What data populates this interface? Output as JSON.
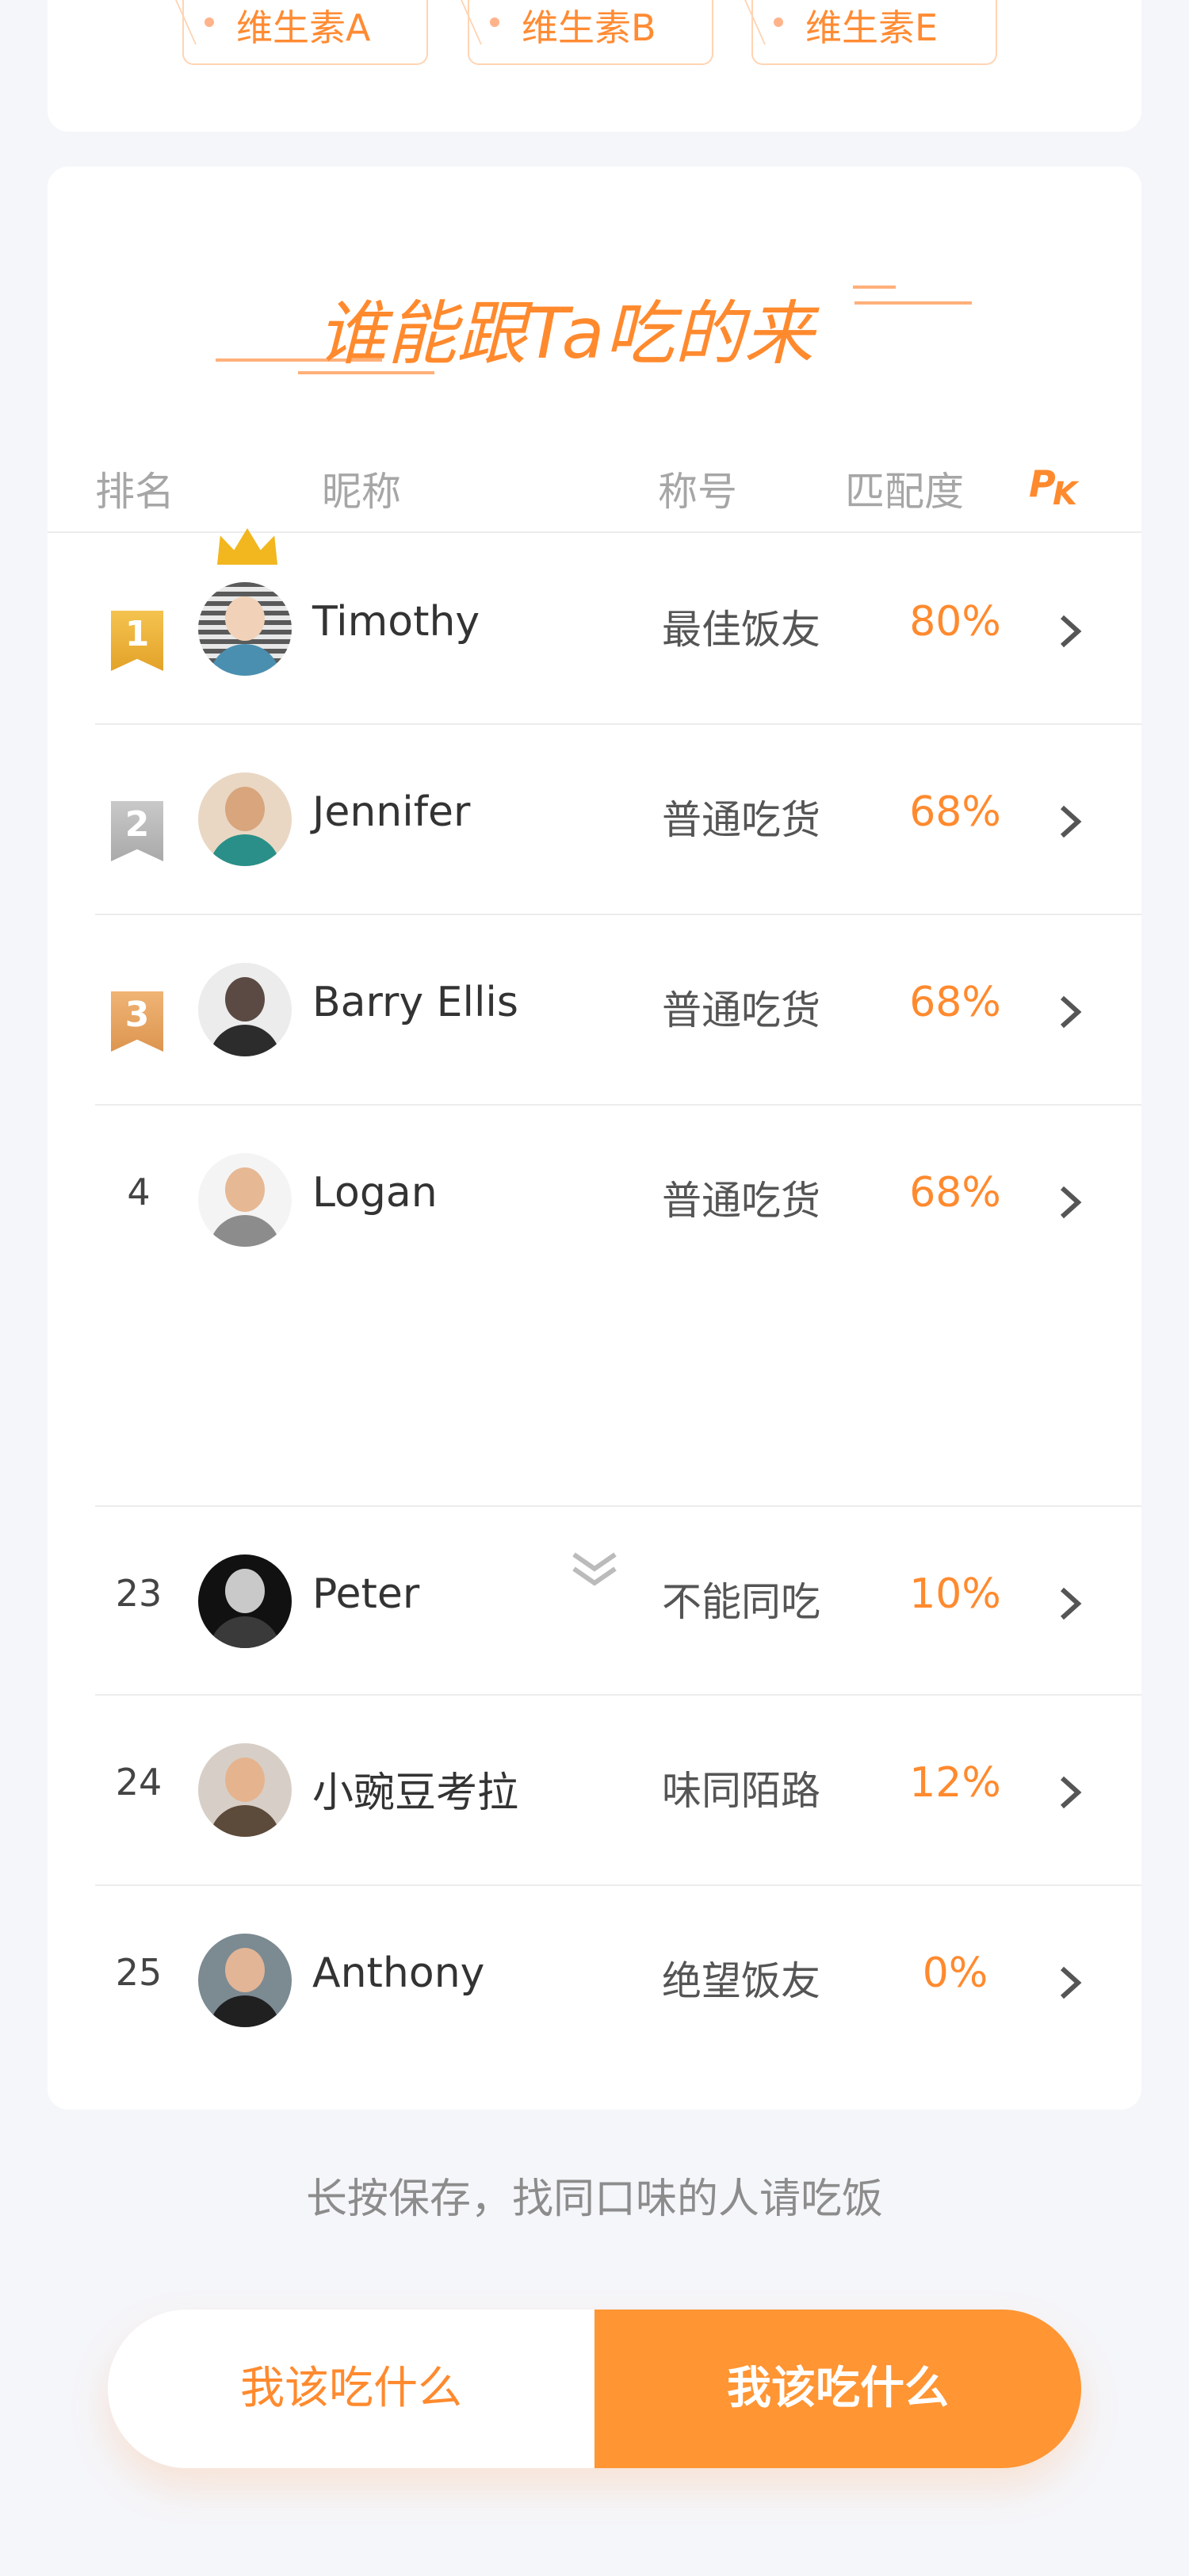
{
  "tags": [
    "维生素A",
    "维生素B",
    "维生素E"
  ],
  "section_title": "谁能跟Ta吃的来",
  "table_header": {
    "rank": "排名",
    "nickname": "昵称",
    "title": "称号",
    "match": "匹配度",
    "pk_icon": "pk-icon"
  },
  "rows_top": [
    {
      "rank": "1",
      "name": "Timothy",
      "title": "最佳饭友",
      "match": "80%"
    },
    {
      "rank": "2",
      "name": "Jennifer",
      "title": "普通吃货",
      "match": "68%"
    },
    {
      "rank": "3",
      "name": "Barry Ellis",
      "title": "普通吃货",
      "match": "68%"
    },
    {
      "rank": "4",
      "name": "Logan",
      "title": "普通吃货",
      "match": "68%"
    }
  ],
  "rows_bottom": [
    {
      "rank": "23",
      "name": "Peter",
      "title": "不能同吃",
      "match": "10%"
    },
    {
      "rank": "24",
      "name": "小豌豆考拉",
      "title": "味同陌路",
      "match": "12%"
    },
    {
      "rank": "25",
      "name": "Anthony",
      "title": "绝望饭友",
      "match": "0%"
    }
  ],
  "footer_text": "长按保存，找同口味的人请吃饭",
  "buttons": {
    "left": "我该吃什么",
    "right": "我该吃什么"
  },
  "colors": {
    "accent": "#ff8a2e",
    "button_bg": "#ff9533"
  }
}
